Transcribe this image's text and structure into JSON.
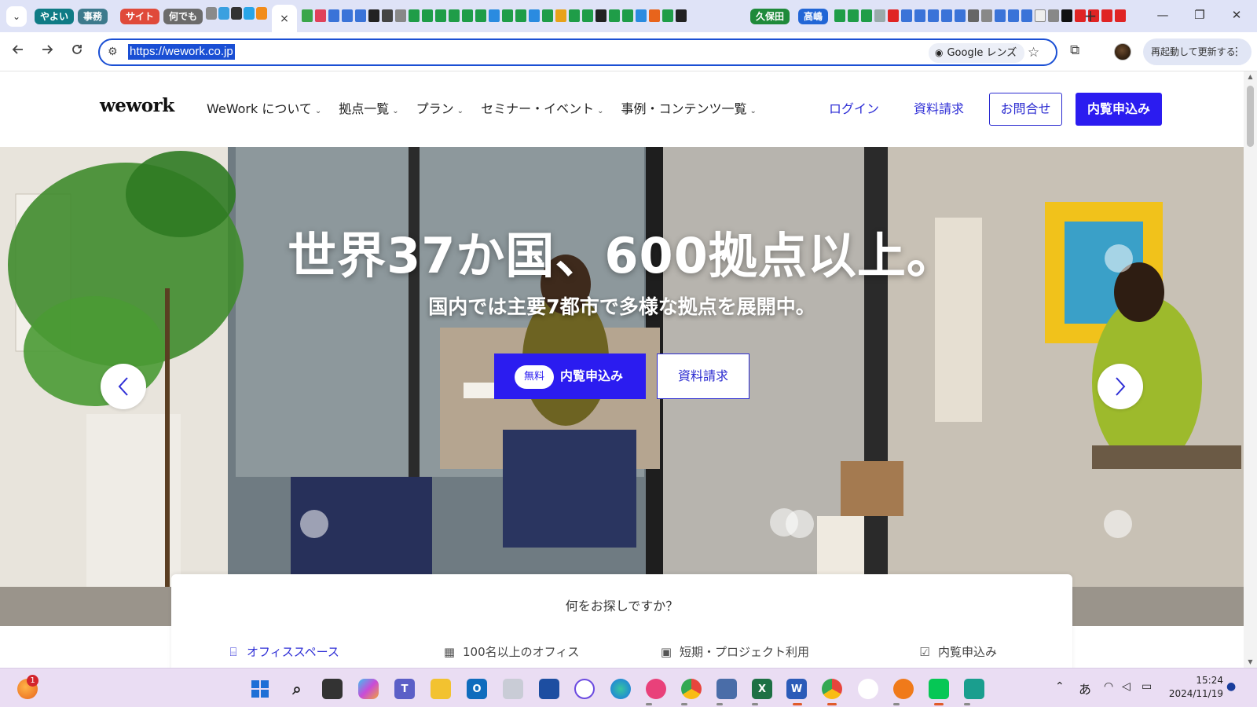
{
  "browser": {
    "tab_groups": [
      {
        "label": "やよい",
        "color": "#0f7b85"
      },
      {
        "label": "事務",
        "color": "#3d7a8c"
      },
      {
        "label": "サイト",
        "color": "#e04a3a"
      },
      {
        "label": "何でも",
        "color": "#6b6b6b"
      },
      {
        "label": "久保田",
        "color": "#1f8a3a"
      },
      {
        "label": "高嶋",
        "color": "#2266d6"
      }
    ],
    "close_tab_symbol": "×",
    "new_tab_symbol": "+",
    "window_controls": {
      "minimize": "—",
      "restore": "❐",
      "close": "✕"
    },
    "address": {
      "url": "https://wework.co.jp",
      "lens_label": "Google レンズ"
    },
    "relaunch_label": "再起動して更新する"
  },
  "site": {
    "logo_text": "wework",
    "nav": [
      {
        "label": "WeWork について"
      },
      {
        "label": "拠点一覧"
      },
      {
        "label": "プラン"
      },
      {
        "label": "セミナー・イベント"
      },
      {
        "label": "事例・コンテンツ一覧"
      }
    ],
    "nav_chevron": "⌄",
    "header_links": {
      "login": "ログイン",
      "brochure": "資料請求",
      "contact": "お問合せ",
      "tour": "内覧申込み"
    },
    "hero": {
      "title": "世界37か国、600拠点以上。",
      "subtitle": "国内では主要7都市で多様な拠点を展開中。",
      "cta_badge": "無料",
      "cta_label": "内覧申込み",
      "secondary_label": "資料請求"
    },
    "search": {
      "title": "何をお探しですか？",
      "options": [
        {
          "label": "オフィススペース",
          "icon": "office-icon"
        },
        {
          "label": "100名以上のオフィス",
          "icon": "building-icon"
        },
        {
          "label": "短期・プロジェクト利用",
          "icon": "calendar-icon"
        },
        {
          "label": "内覧申込み",
          "icon": "calendar-check-icon"
        }
      ]
    },
    "colors": {
      "brand_blue": "#2b1cf0",
      "link_blue": "#2e2ed6"
    }
  },
  "taskbar": {
    "weather_badge": "1",
    "ime_label": "あ",
    "time": "15:24",
    "date": "2024/11/19"
  }
}
